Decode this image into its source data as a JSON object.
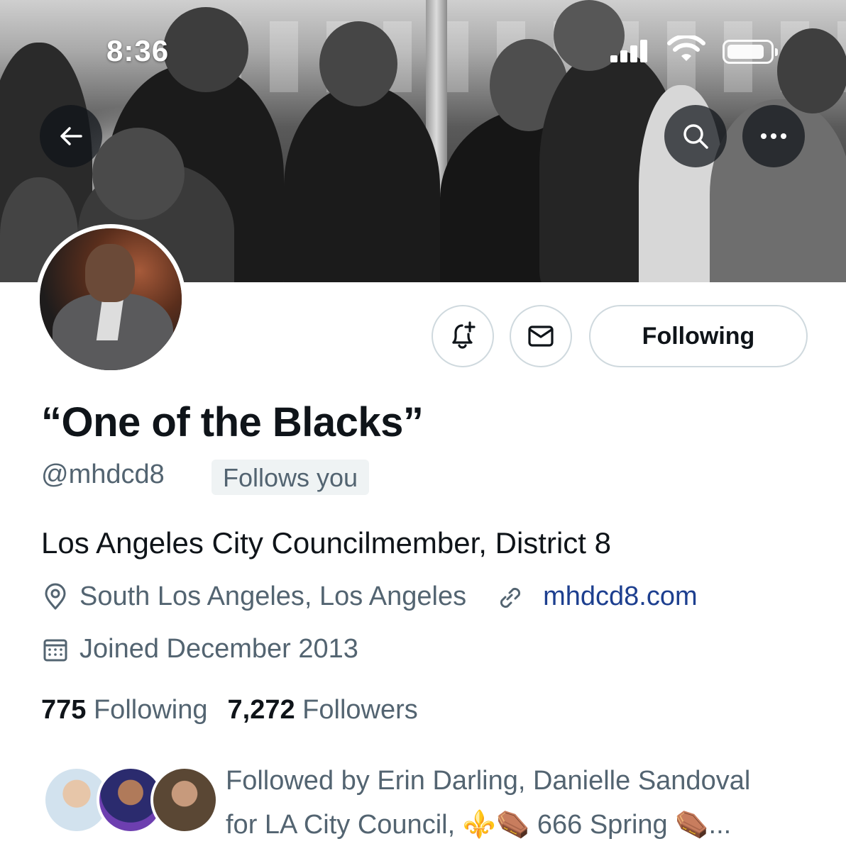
{
  "status_bar": {
    "time": "8:36"
  },
  "profile": {
    "display_name": "“One of the Blacks”",
    "handle": "@mhdcd8",
    "follows_you_badge": "Follows you",
    "bio": "Los Angeles City Councilmember, District 8",
    "location": "South Los Angeles, Los Angeles",
    "website": "mhdcd8.com",
    "joined": "Joined December 2013"
  },
  "stats": {
    "following_count": "775",
    "following_label": "Following",
    "followers_count": "7,272",
    "followers_label": "Followers"
  },
  "actions": {
    "following_button": "Following"
  },
  "followed_by": {
    "line1": "Followed by Erin Darling, Danielle Sandoval",
    "line2": "for LA City Council, ⚜️⚰️ 666 Spring ⚰️..."
  },
  "icons": [
    "back-arrow-icon",
    "search-icon",
    "more-icon",
    "notification-bell-plus-icon",
    "envelope-icon",
    "location-pin-icon",
    "link-icon",
    "calendar-icon",
    "signal-icon",
    "wifi-icon",
    "battery-icon"
  ],
  "colors": {
    "link": "#1d3f8f",
    "secondary_text": "#536471",
    "primary_text": "#0f1419",
    "border": "#cfd9de"
  }
}
